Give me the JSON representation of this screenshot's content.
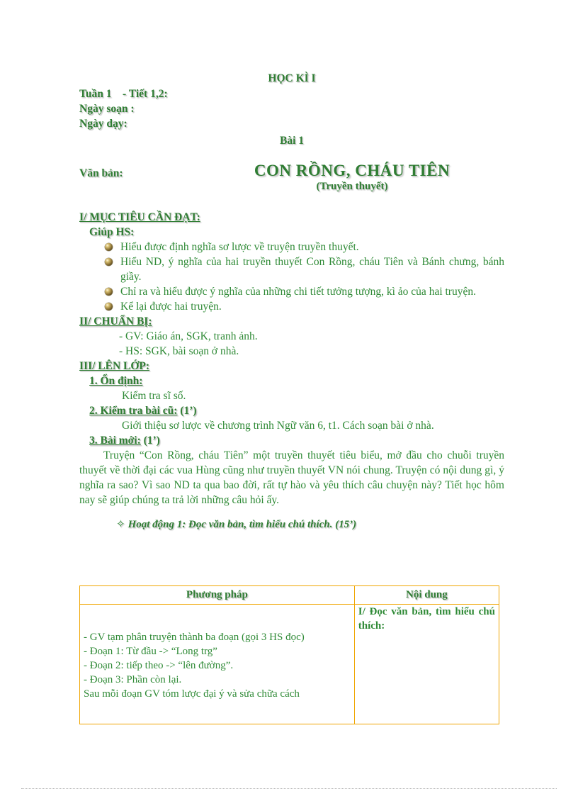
{
  "document": {
    "header_center_top": "HỌC KÌ I",
    "header_center_bai": "Bài 1",
    "meta": {
      "line_week": "Tuần 1    - Tiết 1,2:",
      "line_soan": "Ngày soạn :",
      "line_day": "Ngày dạy:"
    },
    "title_block": {
      "label": "Văn bản:",
      "main_title": "CON RỒNG, CHÁU TIÊN",
      "subtitle": "(Truyền thuyết)"
    },
    "section_I": {
      "heading": "I/ MỤC TIÊU CẦN ĐẠT:",
      "subheading": "Giúp HS:",
      "bullets": [
        "Hiểu được định nghĩa sơ lược về truyện truyền thuyết.",
        "Hiểu ND, ý nghĩa của hai truyền thuyết Con Rồng, cháu Tiên và Bánh chưng, bánh giầy.",
        "Chỉ ra và hiểu được ý nghĩa của những chi tiết tưởng tượng, kì ảo của hai truyện.",
        "Kể lại được hai truyện."
      ]
    },
    "section_II": {
      "heading": "II/ CHUẨN BỊ:",
      "lines": [
        "- GV: Giáo án, SGK, tranh ảnh.",
        "- HS: SGK, bài soạn ở nhà."
      ]
    },
    "section_III": {
      "heading": "III/ LÊN LỚP:",
      "item_1": {
        "heading": "1. Ổn định:",
        "text": "Kiểm tra sĩ số."
      },
      "item_2": {
        "heading": "2. Kiểm tra bài cũ:",
        "time": " (1’)",
        "text": "Giới thiệu sơ lược về chương trình Ngữ văn 6, t1. Cách soạn bài ở nhà."
      },
      "item_3": {
        "heading": "3. Bài mới:",
        "time": " (1’)",
        "paragraph": "Truyện “Con Rồng, cháu Tiên” một truyền thuyết tiêu biểu, mở đầu cho chuỗi truyền thuyết về thời đại các vua Hùng cũng như truyền thuyết VN nói chung. Truyện có nội dung gì, ý nghĩa ra sao? Vì sao ND ta qua bao đời, rất tự hào và yêu thích câu chuyện này? Tiết học hôm nay sẽ giúp chúng ta trả lời những câu hỏi ấy."
      }
    },
    "activity": {
      "icon": "four-point-star-icon",
      "glyph": "✧",
      "text": "Hoạt động 1: Đọc văn bản, tìm hiểu chú thích. (15’)"
    },
    "table": {
      "headers": [
        "Phương pháp",
        "Nội dung"
      ],
      "left_cell_lines": [
        "- GV tạm phân truyện thành ba đoạn (gọi 3 HS đọc)",
        "- Đoạn 1: Từ đầu -> “Long trg”",
        "- Đoạn 2: tiếp theo -> “lên đường”.",
        "- Đoạn 3: Phần còn lại.",
        "Sau mỗi đoạn GV tóm lược đại ý và sửa chữa cách"
      ],
      "right_cell_text": "I/ Đọc văn bản, tìm hiểu chú thích:"
    },
    "colors": {
      "text_green": "#2f8a36",
      "heading_green": "#2f7d33",
      "table_border_orange": "#f0a500",
      "bullet_gold": "#d8bf72",
      "page_background": "#ffffff"
    }
  }
}
